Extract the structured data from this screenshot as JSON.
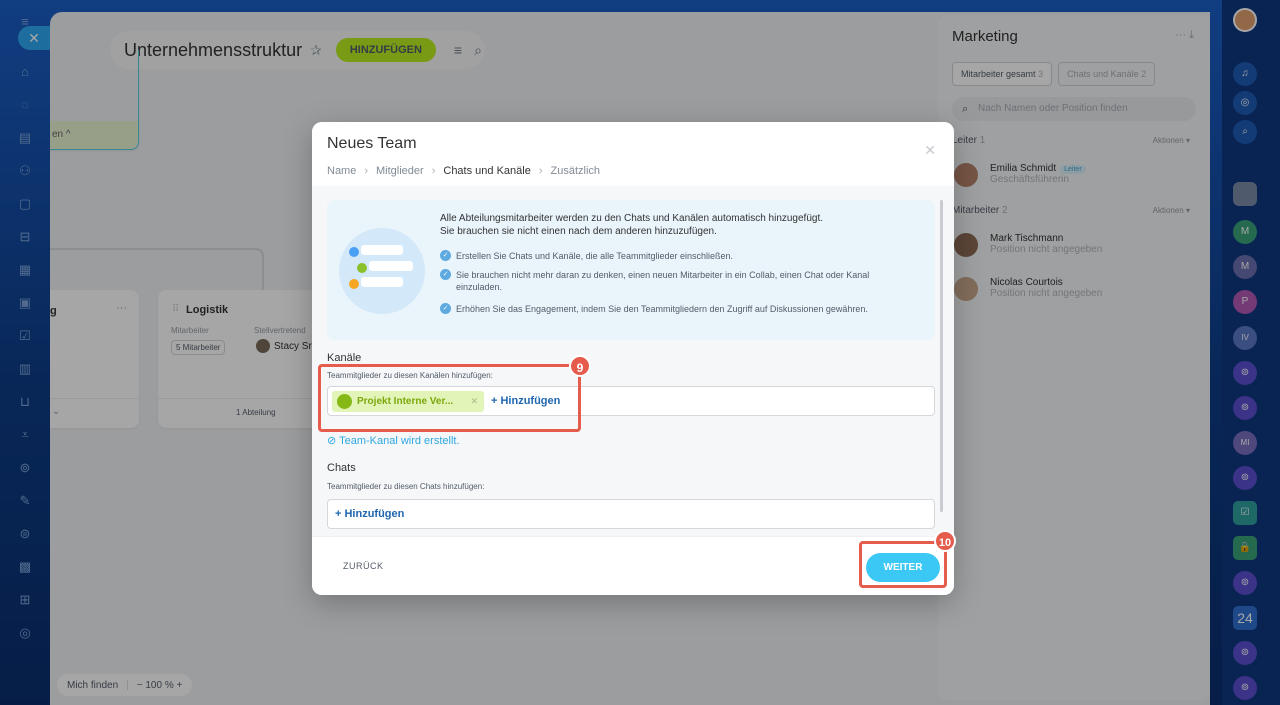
{
  "board": {
    "title": "Unternehmensstruktur",
    "add_label": "HINZUFÜGEN",
    "top_card_footer": "en ^",
    "card1": {
      "title": "g",
      "more": "···"
    },
    "card2": {
      "title": "Logistik",
      "col1": "Mitarbeiter",
      "col2": "Stellvertretend",
      "chip": "5 Mitarbeiter",
      "person": "Stacy Sr",
      "footer": "1 Abteilung"
    },
    "find_me": "Mich finden",
    "zoom": "− 100 % +"
  },
  "right_panel": {
    "title": "Marketing",
    "tabs": [
      {
        "label": "Mitarbeiter gesamt",
        "count": "3"
      },
      {
        "label": "Chats und Kanäle",
        "count": "2"
      }
    ],
    "search_placeholder": "Nach Namen oder Position finden",
    "leader_section": "Leiter",
    "leader_count": "1",
    "employees_section": "Mitarbeiter",
    "employees_count": "2",
    "actions": "Aktionen",
    "leader": {
      "name": "Emilia Schmidt",
      "badge": "Leiter",
      "role": "Geschäftsführerin"
    },
    "employees": [
      {
        "name": "Mark Tischmann",
        "role": "Position nicht angegeben"
      },
      {
        "name": "Nicolas Courtois",
        "role": "Position nicht angegeben"
      }
    ]
  },
  "right_rail": {
    "counter": "24",
    "initials": [
      "M",
      "M",
      "P",
      "IV",
      "MI"
    ]
  },
  "modal": {
    "title": "Neues Team",
    "breadcrumbs": [
      "Name",
      "Mitglieder",
      "Chats und Kanäle",
      "Zusätzlich"
    ],
    "info_heading_1": "Alle Abteilungsmitarbeiter werden zu den Chats und Kanälen automatisch hinzugefügt.",
    "info_heading_2": "Sie brauchen sie nicht einen nach dem anderen hinzuzufügen.",
    "info_bullets": [
      "Erstellen Sie Chats und Kanäle, die alle Teammitglieder einschließen.",
      "Sie brauchen nicht mehr daran zu denken, einen neuen Mitarbeiter in ein Collab, einen Chat oder Kanal einzuladen.",
      "Erhöhen Sie das Engagement, indem Sie den Teammitgliedern den Zugriff auf Diskussionen gewähren."
    ],
    "channels_label": "Kanäle",
    "channels_sub": "Teammitglieder zu diesen Kanälen hinzufügen:",
    "channel_pill": "Projekt Interne Ver...",
    "add_label": "+ Hinzufügen",
    "channel_status": "Team-Kanal wird erstellt.",
    "chats_label": "Chats",
    "chats_sub": "Teammitglieder zu diesen Chats hinzufügen:",
    "back_label": "ZURÜCK",
    "next_label": "WEITER"
  },
  "annotations": {
    "step_a": "9",
    "step_b": "10",
    "color": "#e55b4c"
  }
}
